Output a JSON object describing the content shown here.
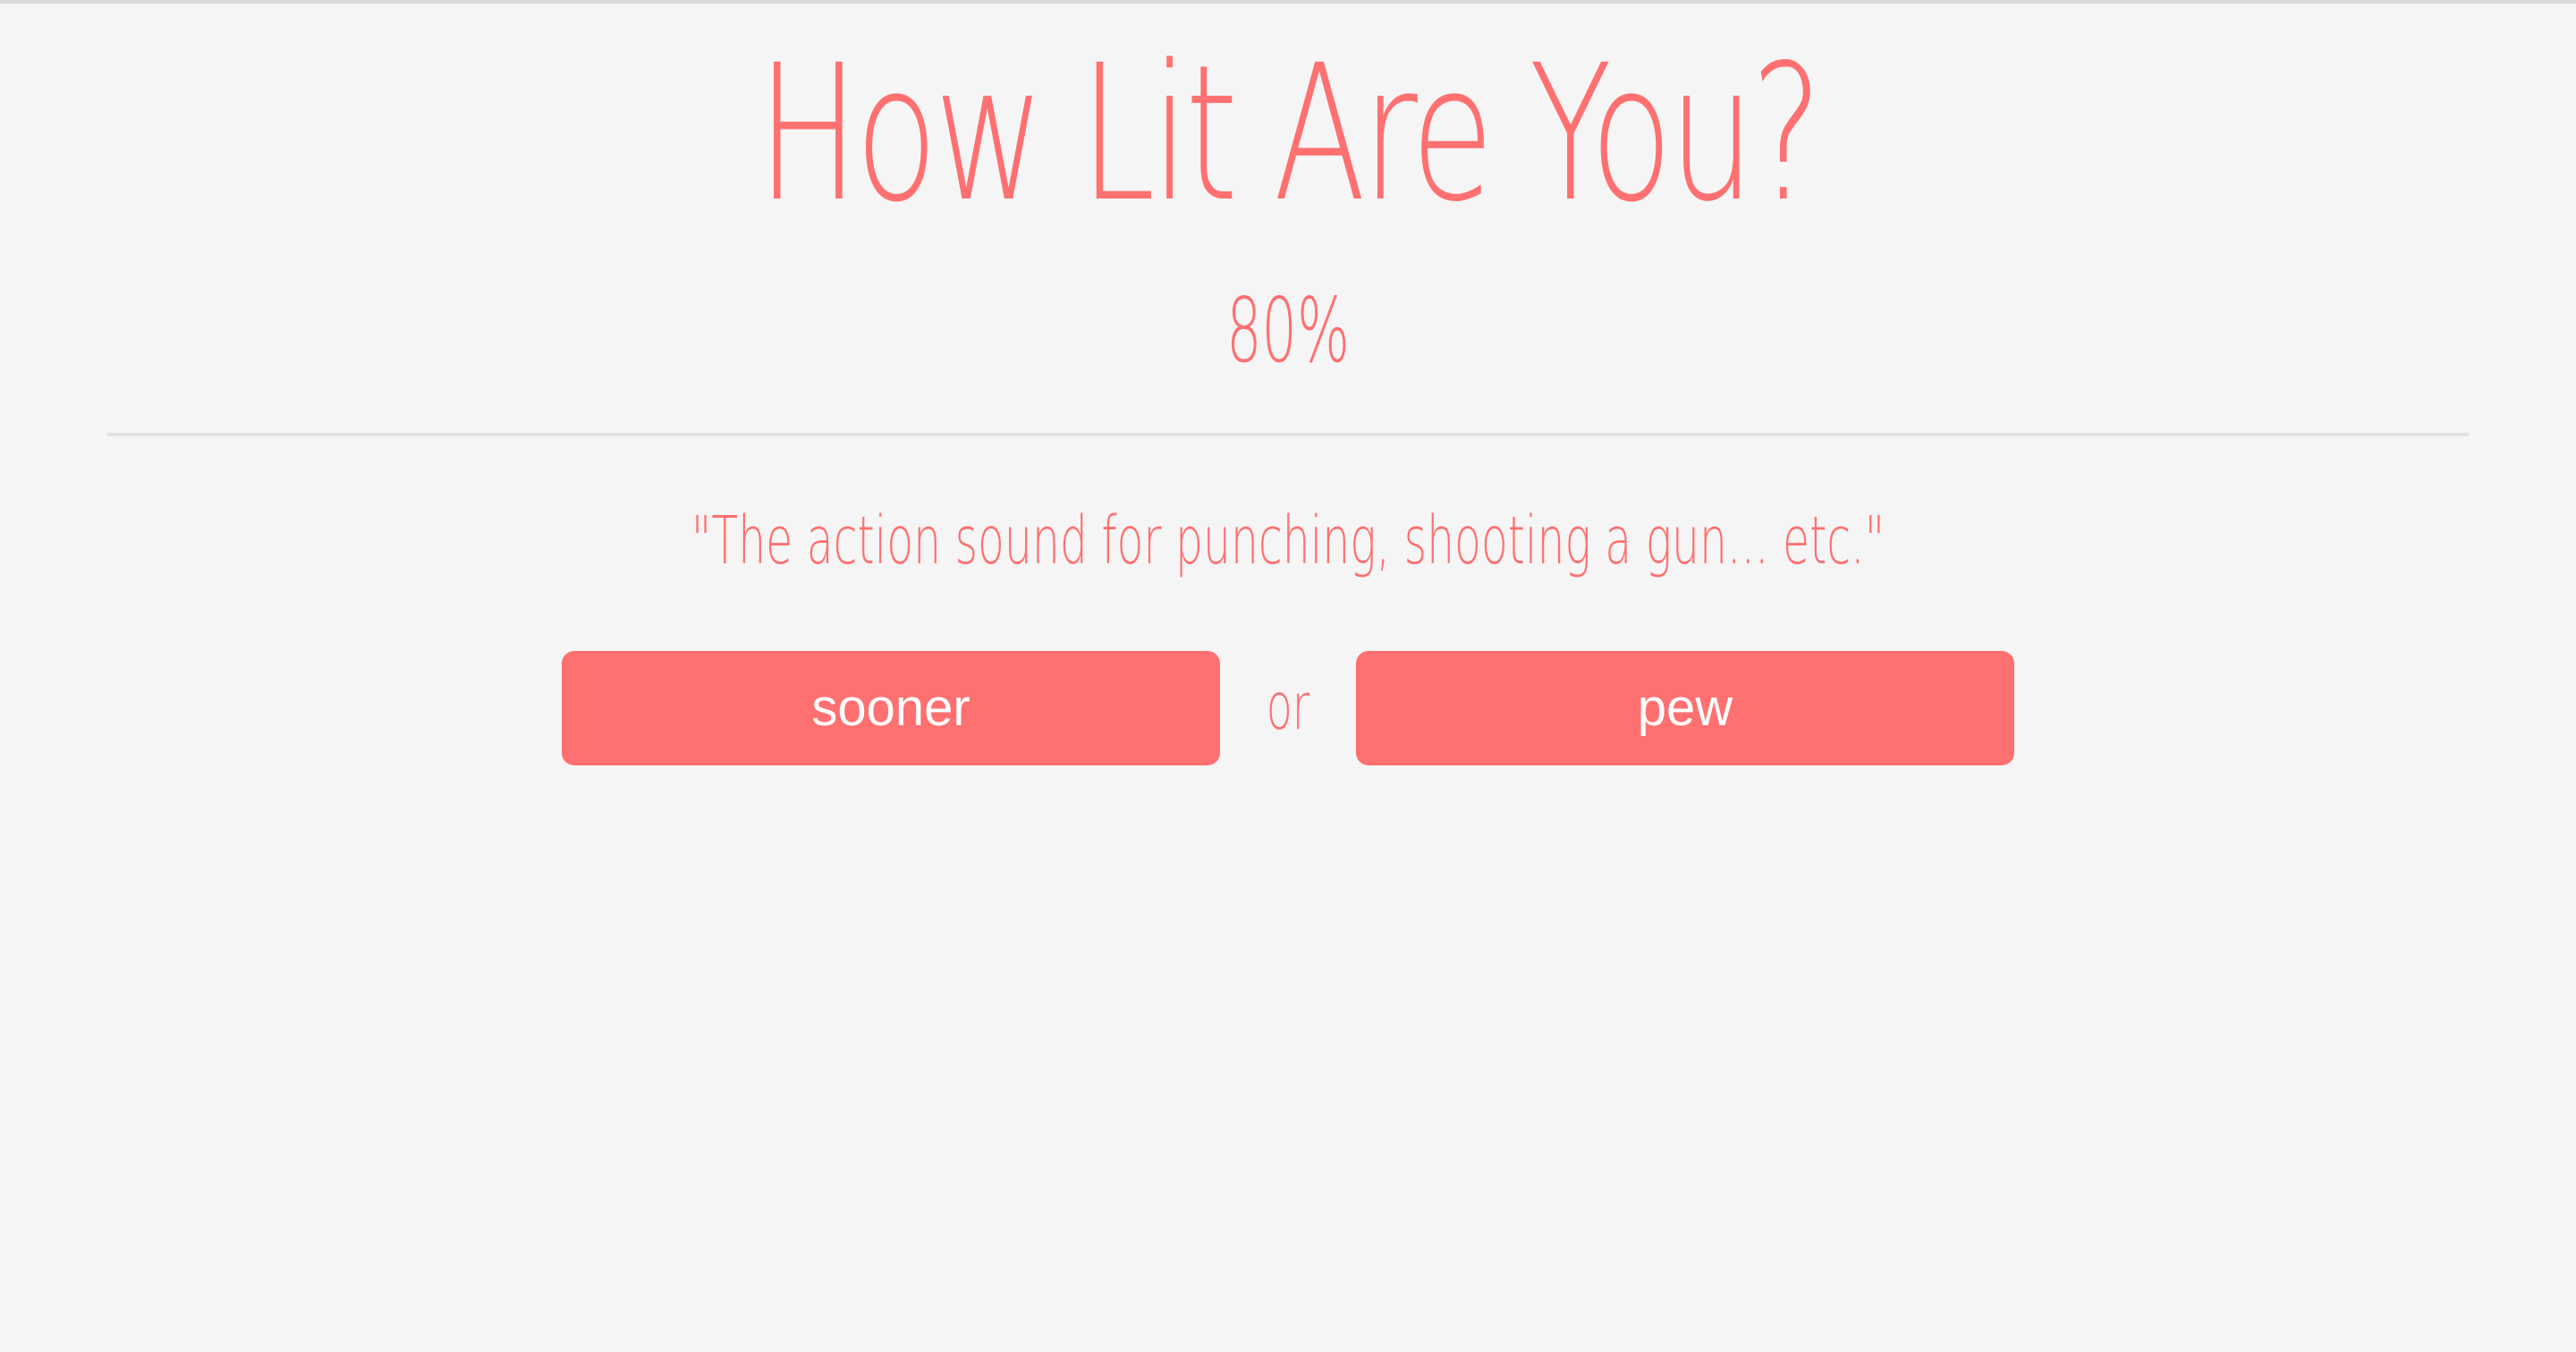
{
  "header": {
    "title": "How Lit Are You?",
    "score": "80%"
  },
  "question": {
    "definition": "\"The action sound for punching, shooting a gun... etc.\""
  },
  "choices": {
    "left_label": "sooner",
    "separator": "or",
    "right_label": "pew"
  },
  "colors": {
    "accent": "#ff7070",
    "background": "#f5f5f5",
    "button_text": "#ffffff",
    "divider": "#e0e0e0"
  }
}
